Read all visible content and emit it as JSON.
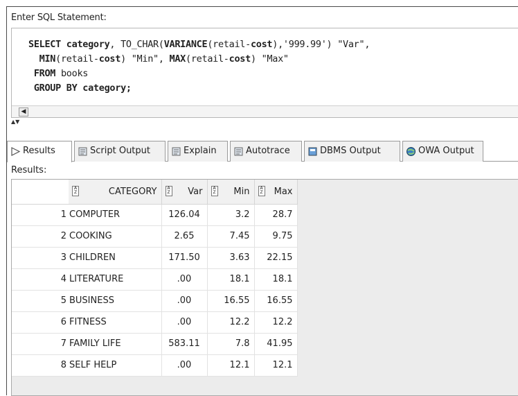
{
  "editor": {
    "label": "Enter SQL Statement:",
    "lines": [
      [
        {
          "t": "SELECT ",
          "b": true
        },
        {
          "t": "category",
          "b": true
        },
        {
          "t": ", TO_CHAR(",
          "b": false
        },
        {
          "t": "VARIANCE",
          "b": true
        },
        {
          "t": "(retail-",
          "b": false
        },
        {
          "t": "cost",
          "b": true
        },
        {
          "t": "),'999.99') \"Var\",",
          "b": false
        }
      ],
      [
        {
          "t": "  ",
          "b": false
        },
        {
          "t": "MIN",
          "b": true
        },
        {
          "t": "(retail-",
          "b": false
        },
        {
          "t": "cost",
          "b": true
        },
        {
          "t": ") \"Min\", ",
          "b": false
        },
        {
          "t": "MAX",
          "b": true
        },
        {
          "t": "(retail-",
          "b": false
        },
        {
          "t": "cost",
          "b": true
        },
        {
          "t": ") \"Max\"",
          "b": false
        }
      ],
      [
        {
          "t": " FROM",
          "b": true
        },
        {
          "t": " books",
          "b": false
        }
      ],
      [
        {
          "t": " GROUP BY category;",
          "b": true
        }
      ]
    ]
  },
  "tabs": [
    {
      "label": "Results",
      "icon": "play-arrow-icon",
      "active": true
    },
    {
      "label": "Script Output",
      "icon": "script-icon",
      "active": false
    },
    {
      "label": "Explain",
      "icon": "explain-icon",
      "active": false
    },
    {
      "label": "Autotrace",
      "icon": "autotrace-icon",
      "active": false
    },
    {
      "label": "DBMS Output",
      "icon": "dbms-icon",
      "active": false
    },
    {
      "label": "OWA Output",
      "icon": "owa-globe-icon",
      "active": false
    }
  ],
  "results": {
    "label": "Results:",
    "columns": [
      "CATEGORY",
      "Var",
      "Min",
      "Max"
    ],
    "rows": [
      {
        "n": "1",
        "category": "COMPUTER",
        "var": "126.04",
        "min": "3.2",
        "max": "28.7"
      },
      {
        "n": "2",
        "category": "COOKING",
        "var": "2.65",
        "min": "7.45",
        "max": "9.75"
      },
      {
        "n": "3",
        "category": "CHILDREN",
        "var": "171.50",
        "min": "3.63",
        "max": "22.15"
      },
      {
        "n": "4",
        "category": "LITERATURE",
        "var": ".00",
        "min": "18.1",
        "max": "18.1"
      },
      {
        "n": "5",
        "category": "BUSINESS",
        "var": ".00",
        "min": "16.55",
        "max": "16.55"
      },
      {
        "n": "6",
        "category": "FITNESS",
        "var": ".00",
        "min": "12.2",
        "max": "12.2"
      },
      {
        "n": "7",
        "category": "FAMILY LIFE",
        "var": "583.11",
        "min": "7.8",
        "max": "41.95"
      },
      {
        "n": "8",
        "category": "SELF HELP",
        "var": ".00",
        "min": "12.1",
        "max": "12.1"
      }
    ]
  }
}
